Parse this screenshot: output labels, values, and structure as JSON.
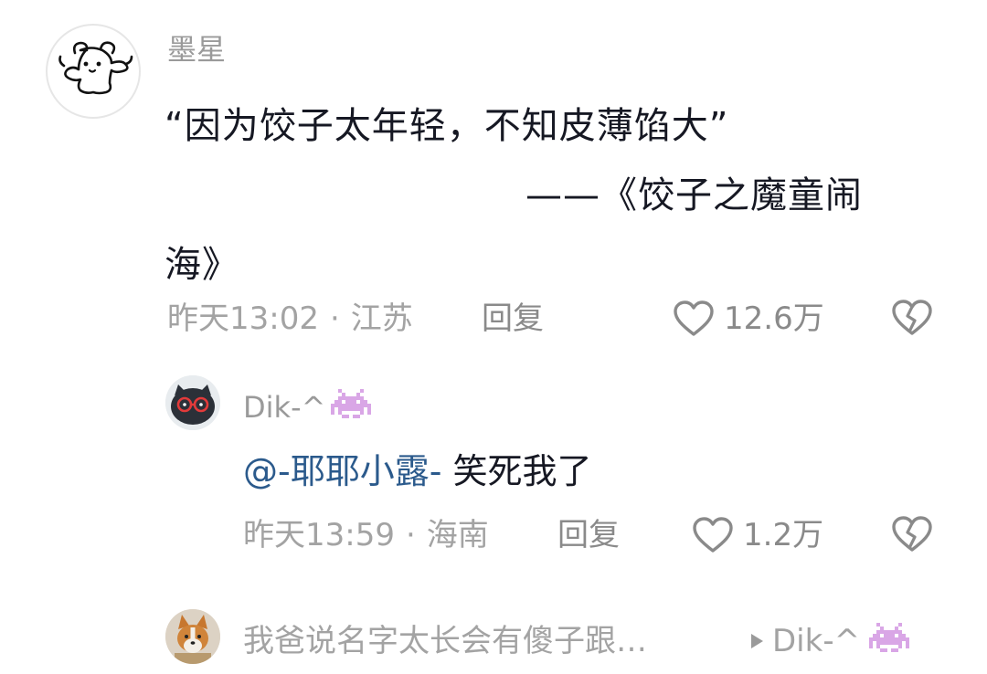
{
  "comment": {
    "username": "墨星",
    "body_line1": "“因为饺子太年轻，不知皮薄馅大”",
    "body_attrib": "——《饺子之魔童闹",
    "body_attrib_end": "海》",
    "time": "昨天13:02",
    "location": "江苏",
    "reply_label": "回复",
    "likes": "12.6万"
  },
  "reply": {
    "username": "Dik-^",
    "mention": "@-耶耶小露-",
    "text": " 笑死我了",
    "time": "昨天13:59",
    "location": "海南",
    "reply_label": "回复",
    "likes": "1.2万"
  },
  "collapsed_reply": {
    "text": "我爸说名字太长会有傻子跟…",
    "target": "Dik-^"
  },
  "separator": "·",
  "colors": {
    "meta_gray": "#a3a3a3",
    "mention_blue": "#2b5a8c",
    "badge_purple": "#d9a6e6"
  },
  "icons": [
    "bear-avatar",
    "heart-icon",
    "broken-heart-icon",
    "space-invader-badge-icon",
    "cat-glasses-avatar",
    "corgi-avatar",
    "play-triangle-icon"
  ]
}
